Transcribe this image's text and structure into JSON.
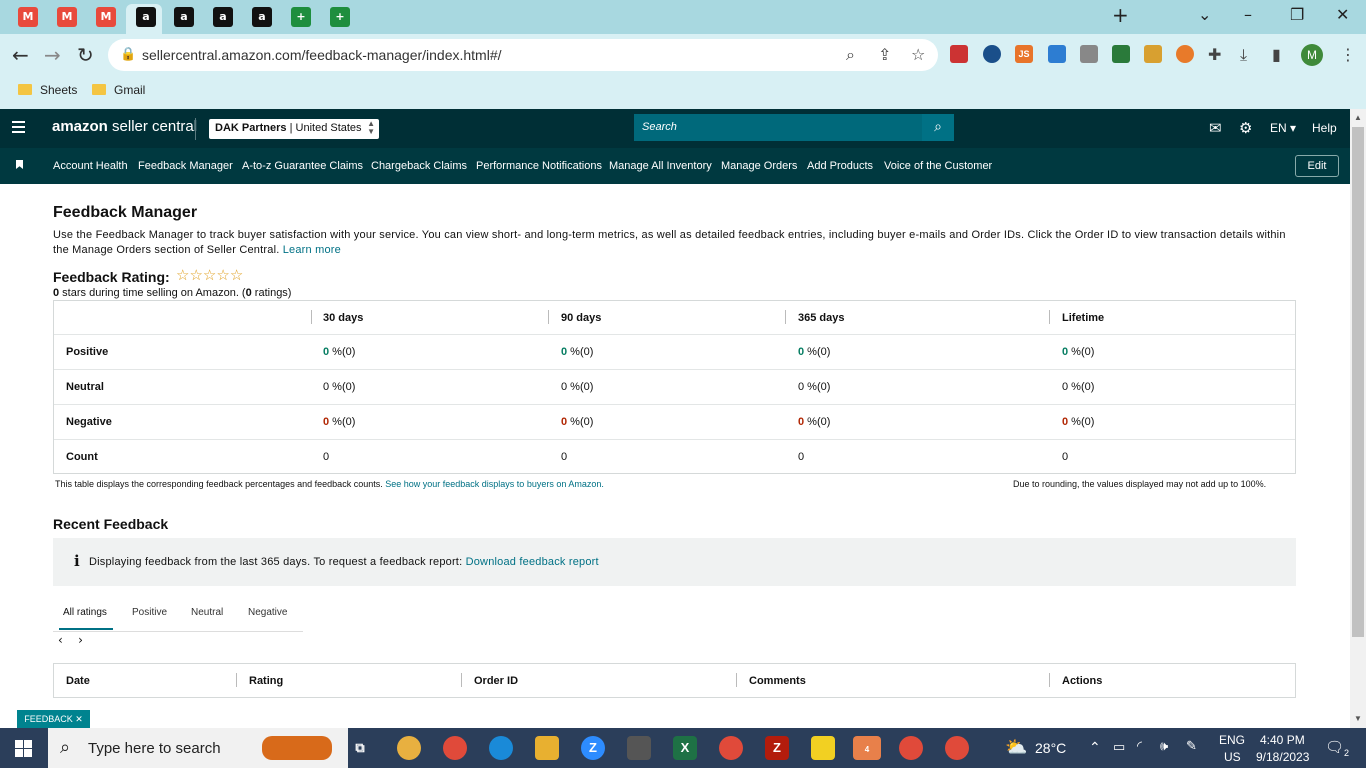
{
  "browser": {
    "url": "sellercentral.amazon.com/feedback-manager/index.html#/",
    "bookmarks": [
      "Sheets",
      "Gmail"
    ],
    "profile_initial": "M",
    "tab_icons": [
      {
        "name": "gmail-icon",
        "label": "M",
        "color": "#e84a3c"
      },
      {
        "name": "gmail-icon",
        "label": "M",
        "color": "#e84a3c"
      },
      {
        "name": "gmail-icon",
        "label": "M",
        "color": "#e84a3c"
      },
      {
        "name": "amazon-icon",
        "label": "a",
        "color": "#111111"
      },
      {
        "name": "amazon-icon",
        "label": "a",
        "color": "#111111"
      },
      {
        "name": "amazon-icon",
        "label": "a",
        "color": "#111111"
      },
      {
        "name": "amazon-icon",
        "label": "a",
        "color": "#111111"
      },
      {
        "name": "sheets-icon",
        "label": "+",
        "color": "#1e8e3e"
      },
      {
        "name": "sheets-icon",
        "label": "+",
        "color": "#1e8e3e"
      }
    ]
  },
  "header": {
    "logo_brand": "amazon",
    "logo_product": "seller central",
    "account_name": "DAK Partners",
    "account_region": "United States",
    "search_placeholder": "Search",
    "language": "EN",
    "help_label": "Help"
  },
  "nav": {
    "items": [
      "Account Health",
      "Feedback Manager",
      "A-to-z Guarantee Claims",
      "Chargeback Claims",
      "Performance Notifications",
      "Manage All Inventory",
      "Manage Orders",
      "Add Products",
      "Voice of the Customer"
    ],
    "edit_label": "Edit"
  },
  "page": {
    "title": "Feedback Manager",
    "description": "Use the Feedback Manager to track buyer satisfaction with your service. You can view short- and long-term metrics, as well as detailed feedback entries, including buyer e-mails and Order IDs. Click the Order ID to view transaction details within the Manage Orders section of Seller Central.",
    "learn_more": "Learn more",
    "rating_label": "Feedback Rating:",
    "stars_filled": 0,
    "stars_total": 5,
    "rating_summary_stars": "0",
    "rating_summary_mid": " stars during time selling on Amazon. (",
    "rating_summary_count": "0",
    "rating_summary_end": " ratings)"
  },
  "feedback_table": {
    "columns": [
      "30 days",
      "90 days",
      "365 days",
      "Lifetime"
    ],
    "rows": [
      {
        "label": "Positive",
        "cells": [
          {
            "pct": "0",
            "rest": " %(0)"
          },
          {
            "pct": "0",
            "rest": " %(0)"
          },
          {
            "pct": "0",
            "rest": " %(0)"
          },
          {
            "pct": "0",
            "rest": " %(0)"
          }
        ]
      },
      {
        "label": "Neutral",
        "cells": [
          {
            "pct": "0",
            "rest": " %(0)"
          },
          {
            "pct": "0",
            "rest": " %(0)"
          },
          {
            "pct": "0",
            "rest": " %(0)"
          },
          {
            "pct": "0",
            "rest": " %(0)"
          }
        ]
      },
      {
        "label": "Negative",
        "cells": [
          {
            "pct": "0",
            "rest": " %(0)"
          },
          {
            "pct": "0",
            "rest": " %(0)"
          },
          {
            "pct": "0",
            "rest": " %(0)"
          },
          {
            "pct": "0",
            "rest": " %(0)"
          }
        ]
      },
      {
        "label": "Count",
        "cells": [
          {
            "pct": "",
            "rest": "0"
          },
          {
            "pct": "",
            "rest": "0"
          },
          {
            "pct": "",
            "rest": "0"
          },
          {
            "pct": "",
            "rest": "0"
          }
        ]
      }
    ],
    "note": "This table displays the corresponding feedback percentages and feedback counts.",
    "note_link": "See how your feedback displays to buyers on Amazon.",
    "rounding_note": "Due to rounding, the values displayed may not add up to 100%."
  },
  "recent": {
    "title": "Recent Feedback",
    "info_text": "Displaying feedback from the last 365 days. To request a feedback report:",
    "info_link": "Download feedback report",
    "tabs": [
      "All ratings",
      "Positive",
      "Neutral",
      "Negative"
    ],
    "columns": [
      "Date",
      "Rating",
      "Order ID",
      "Comments",
      "Actions"
    ]
  },
  "feedback_widget": "FEEDBACK ✕",
  "taskbar": {
    "search_placeholder": "Type here to search",
    "weather": "28°C",
    "lang_top": "ENG",
    "lang_bottom": "US",
    "time": "4:40 PM",
    "date": "9/18/2023",
    "notifications": "2",
    "telegram_badge": "4"
  },
  "colors": {
    "header_bg": "#002f36",
    "nav_bg": "#003940",
    "link": "#007185",
    "positive": "#067d62",
    "negative": "#b12704"
  }
}
